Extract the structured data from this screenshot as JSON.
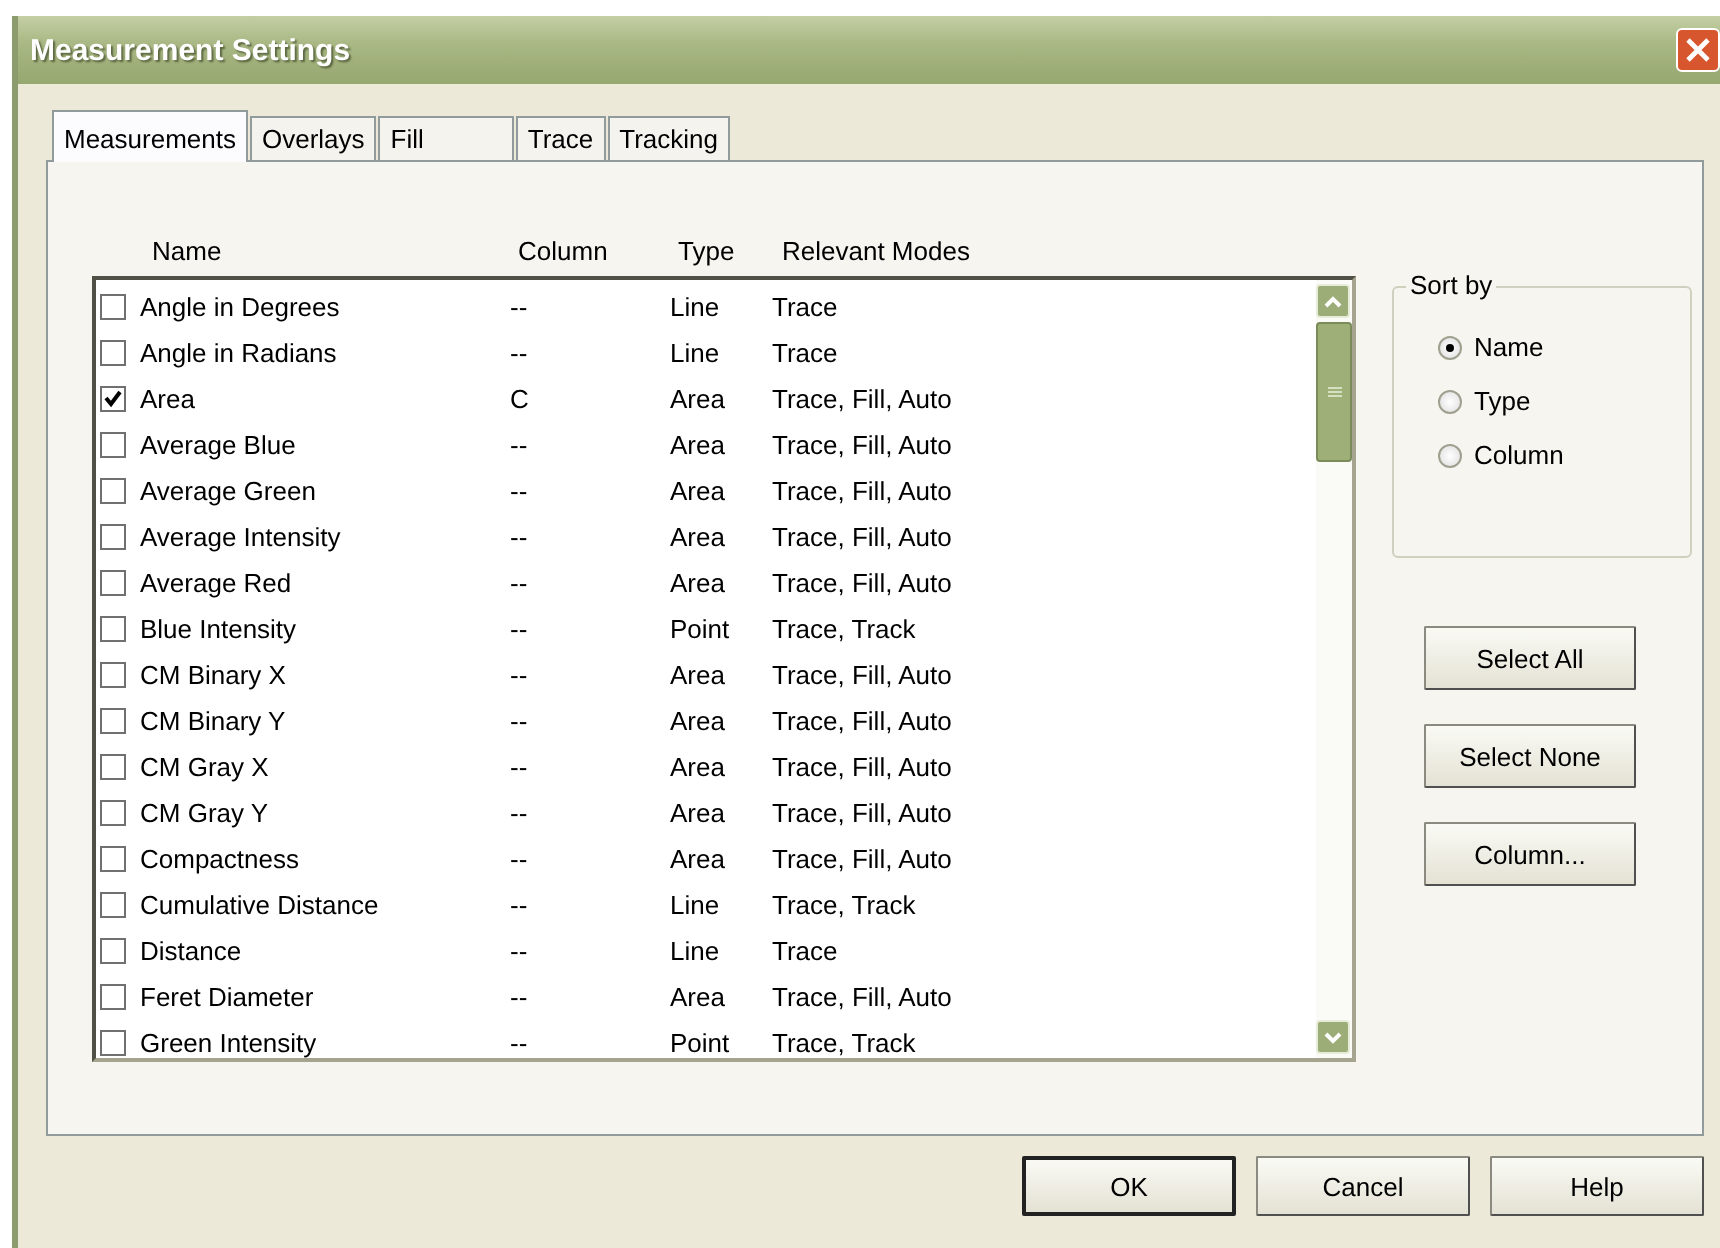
{
  "window": {
    "title": "Measurement Settings"
  },
  "tabs": [
    {
      "label": "Measurements",
      "selected": true
    },
    {
      "label": "Overlays",
      "selected": false
    },
    {
      "label": "Fill",
      "selected": false
    },
    {
      "label": "Trace",
      "selected": false
    },
    {
      "label": "Tracking",
      "selected": false
    }
  ],
  "table": {
    "columns": [
      "Name",
      "Column",
      "Type",
      "Relevant Modes"
    ],
    "rows": [
      {
        "name": "Angle in Degrees",
        "column": "--",
        "type": "Line",
        "modes": "Trace",
        "checked": false
      },
      {
        "name": "Angle in Radians",
        "column": "--",
        "type": "Line",
        "modes": "Trace",
        "checked": false
      },
      {
        "name": "Area",
        "column": "C",
        "type": "Area",
        "modes": "Trace, Fill, Auto",
        "checked": true
      },
      {
        "name": "Average Blue",
        "column": "--",
        "type": "Area",
        "modes": "Trace, Fill, Auto",
        "checked": false
      },
      {
        "name": "Average Green",
        "column": "--",
        "type": "Area",
        "modes": "Trace, Fill, Auto",
        "checked": false
      },
      {
        "name": "Average Intensity",
        "column": "--",
        "type": "Area",
        "modes": "Trace, Fill, Auto",
        "checked": false
      },
      {
        "name": "Average Red",
        "column": "--",
        "type": "Area",
        "modes": "Trace, Fill, Auto",
        "checked": false
      },
      {
        "name": "Blue Intensity",
        "column": "--",
        "type": "Point",
        "modes": "Trace, Track",
        "checked": false
      },
      {
        "name": "CM Binary X",
        "column": "--",
        "type": "Area",
        "modes": "Trace, Fill, Auto",
        "checked": false
      },
      {
        "name": "CM Binary Y",
        "column": "--",
        "type": "Area",
        "modes": "Trace, Fill, Auto",
        "checked": false
      },
      {
        "name": "CM Gray X",
        "column": "--",
        "type": "Area",
        "modes": "Trace, Fill, Auto",
        "checked": false
      },
      {
        "name": "CM Gray Y",
        "column": "--",
        "type": "Area",
        "modes": "Trace, Fill, Auto",
        "checked": false
      },
      {
        "name": "Compactness",
        "column": "--",
        "type": "Area",
        "modes": "Trace, Fill, Auto",
        "checked": false
      },
      {
        "name": "Cumulative Distance",
        "column": "--",
        "type": "Line",
        "modes": "Trace, Track",
        "checked": false
      },
      {
        "name": "Distance",
        "column": "--",
        "type": "Line",
        "modes": "Trace",
        "checked": false
      },
      {
        "name": "Feret Diameter",
        "column": "--",
        "type": "Area",
        "modes": "Trace, Fill, Auto",
        "checked": false
      },
      {
        "name": "Green Intensity",
        "column": "--",
        "type": "Point",
        "modes": "Trace, Track",
        "checked": false
      }
    ]
  },
  "sort_by": {
    "title": "Sort by",
    "options": [
      {
        "label": "Name",
        "selected": true
      },
      {
        "label": "Type",
        "selected": false
      },
      {
        "label": "Column",
        "selected": false
      }
    ]
  },
  "side_buttons": [
    "Select All",
    "Select None",
    "Column..."
  ],
  "buttons": [
    {
      "label": "OK",
      "default": true
    },
    {
      "label": "Cancel",
      "default": false
    },
    {
      "label": "Help",
      "default": false
    }
  ]
}
